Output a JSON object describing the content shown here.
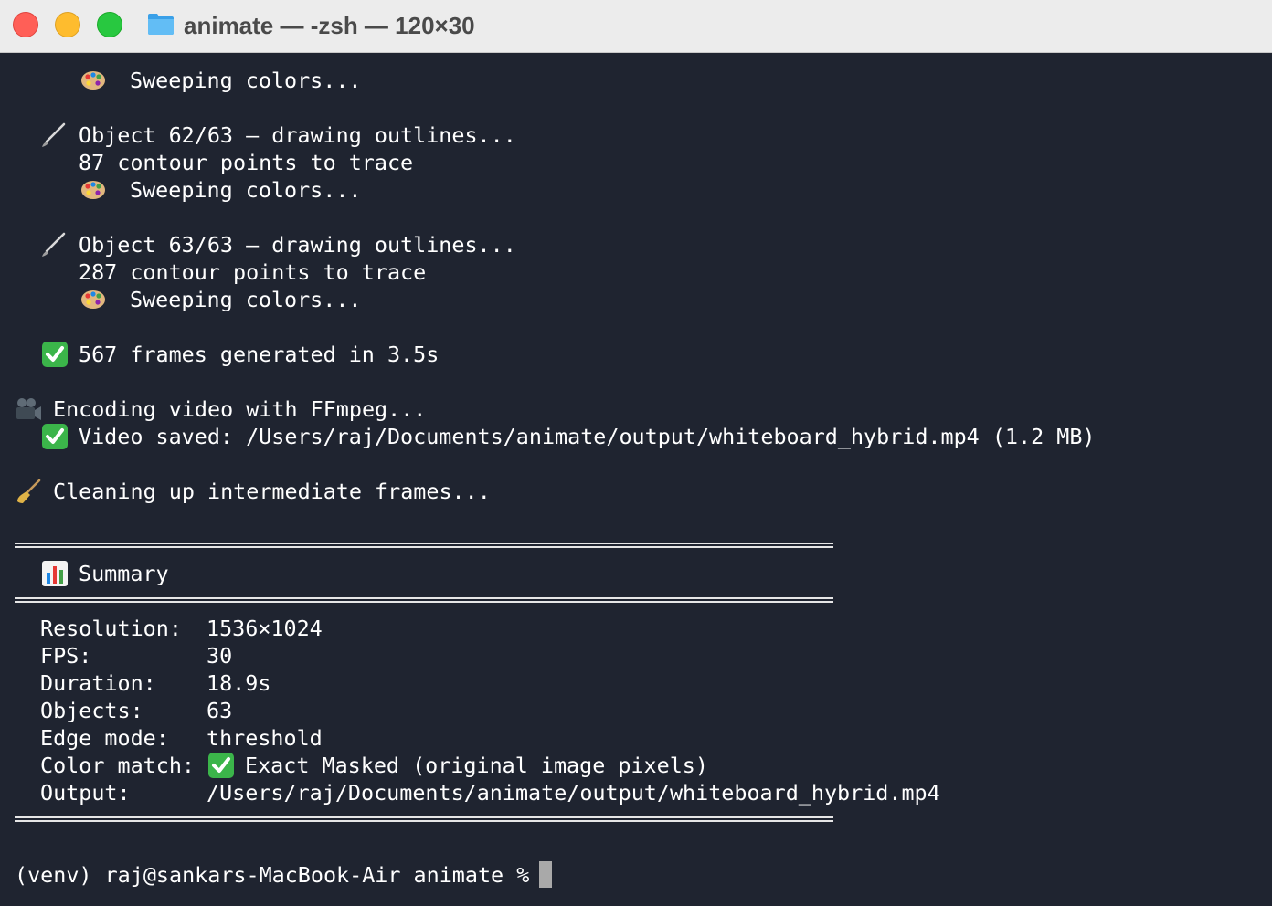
{
  "window": {
    "title": "animate — -zsh — 120×30",
    "title_icon": "folder-icon",
    "traffic_lights": {
      "close": "#ff5f57",
      "minimize": "#febc2e",
      "zoom": "#28c840"
    }
  },
  "colors": {
    "terminal_bg": "#1f2430",
    "terminal_fg": "#ffffff",
    "titlebar_bg": "#ececec"
  },
  "output": {
    "sweep_1": "Sweeping colors...",
    "obj62_title": "Object 62/63 — drawing outlines...",
    "obj62_points": "87 contour points to trace",
    "sweep_2": "Sweeping colors...",
    "obj63_title": "Object 63/63 — drawing outlines...",
    "obj63_points": "287 contour points to trace",
    "sweep_3": "Sweeping colors...",
    "frames_done": "567 frames generated in 3.5s",
    "encoding": "Encoding video with FFmpeg...",
    "video_saved": "Video saved: /Users/raj/Documents/animate/output/whiteboard_hybrid.mp4 (1.2 MB)",
    "cleanup": "Cleaning up intermediate frames..."
  },
  "icons": {
    "palette": "palette-icon",
    "brush": "paintbrush-icon",
    "check": "check-mark-icon",
    "camera": "movie-camera-icon",
    "broom": "broom-icon",
    "chart": "bar-chart-icon"
  },
  "summary": {
    "heading": "Summary",
    "rows": [
      {
        "label": "Resolution:",
        "value": "1536×1024"
      },
      {
        "label": "FPS:",
        "value": "30"
      },
      {
        "label": "Duration:",
        "value": "18.9s"
      },
      {
        "label": "Objects:",
        "value": "63"
      },
      {
        "label": "Edge mode:",
        "value": "threshold"
      },
      {
        "label": "Color match:",
        "value": "Exact Masked (original image pixels)"
      },
      {
        "label": "Output:",
        "value": "/Users/raj/Documents/animate/output/whiteboard_hybrid.mp4"
      }
    ]
  },
  "prompt": {
    "text": "(venv) raj@sankars-MacBook-Air animate % "
  }
}
